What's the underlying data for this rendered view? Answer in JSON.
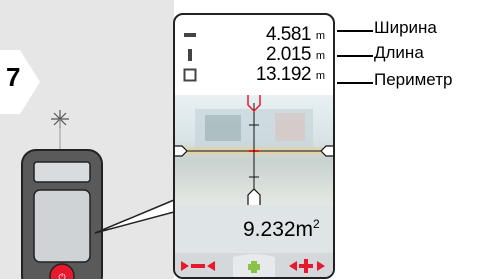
{
  "step": "7",
  "measurements": [
    {
      "icon": "width-icon",
      "value": "4.581",
      "unit": "m",
      "label": "Ширина"
    },
    {
      "icon": "length-icon",
      "value": "2.015",
      "unit": "m",
      "label": "Длина"
    },
    {
      "icon": "perimeter-icon",
      "value": "13.192",
      "unit": "m",
      "label": "Периметр"
    }
  ],
  "area": {
    "value": "9.232m",
    "sup": "2"
  },
  "colors": {
    "accent": "#e8192c",
    "screen_border": "#222222",
    "left_bg": "#e6e6e6",
    "softkey_bg": "#d4d8db"
  }
}
